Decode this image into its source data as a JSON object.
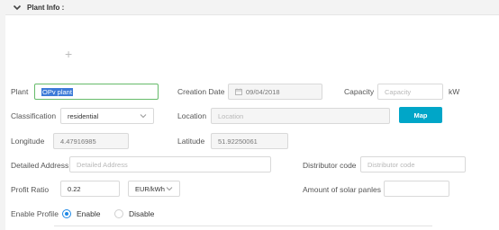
{
  "section": {
    "title": "Plant Info :"
  },
  "form": {
    "plant": {
      "label": "Plant",
      "value": "OPv plant"
    },
    "creation_date": {
      "label": "Creation Date",
      "value": "09/04/2018"
    },
    "capacity": {
      "label": "Capacity",
      "placeholder": "Capacity",
      "unit": "kW"
    },
    "classification": {
      "label": "Classification",
      "value": "residential"
    },
    "location": {
      "label": "Location",
      "placeholder": "Location",
      "map_button": "Map"
    },
    "longitude": {
      "label": "Longitude",
      "value": "4.47916985"
    },
    "latitude": {
      "label": "Latitude",
      "value": "51.92250061"
    },
    "detailed_address": {
      "label": "Detailed Address",
      "placeholder": "Detailed Address"
    },
    "distributor_code": {
      "label": "Distributor code",
      "placeholder": "Distributor code"
    },
    "profit_ratio": {
      "label": "Profit Ratio",
      "value": "0.22",
      "currency": "EUR/kWh"
    },
    "solar_panels": {
      "label": "Amount of solar panles",
      "value": ""
    },
    "enable_profile": {
      "label": "Enable Profile",
      "options": [
        "Enable",
        "Disable"
      ],
      "selected": "Enable"
    }
  },
  "icons": {
    "collapse": "chevron-down-icon",
    "add": "plus-icon",
    "calendar": "calendar-icon"
  },
  "colors": {
    "accent": "#00a6c8",
    "focus_border": "#66bb6a",
    "radio_selected": "#1e88e5"
  }
}
